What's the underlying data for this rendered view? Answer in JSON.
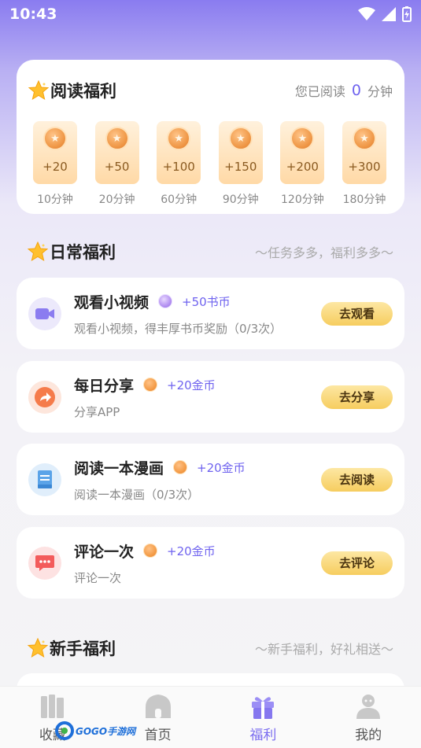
{
  "status_bar": {
    "time": "10:43"
  },
  "reading_welfare": {
    "title": "阅读福利",
    "read_prefix": "您已阅读",
    "read_minutes": "0",
    "read_suffix": "分钟",
    "rewards": [
      {
        "amount": "+20",
        "time": "10分钟"
      },
      {
        "amount": "+50",
        "time": "20分钟"
      },
      {
        "amount": "+100",
        "time": "60分钟"
      },
      {
        "amount": "+150",
        "time": "90分钟"
      },
      {
        "amount": "+200",
        "time": "120分钟"
      },
      {
        "amount": "+300",
        "time": "180分钟"
      }
    ]
  },
  "daily_welfare": {
    "title": "日常福利",
    "subtitle": "～任务多多，福利多多～",
    "tasks": [
      {
        "name": "观看小视频",
        "reward": "+50书币",
        "desc": "观看小视频，得丰厚书币奖励（0/3次）",
        "button": "去观看",
        "coin": "purple-coin-icon"
      },
      {
        "name": "每日分享",
        "reward": "+20金币",
        "desc": "分享APP",
        "button": "去分享",
        "coin": "gold-coin-icon"
      },
      {
        "name": "阅读一本漫画",
        "reward": "+20金币",
        "desc": "阅读一本漫画（0/3次）",
        "button": "去阅读",
        "coin": "gold-coin-icon"
      },
      {
        "name": "评论一次",
        "reward": "+20金币",
        "desc": "评论一次",
        "button": "去评论",
        "coin": "gold-coin-icon"
      }
    ]
  },
  "newbie_welfare": {
    "title": "新手福利",
    "subtitle": "～新手福利，好礼相送～"
  },
  "bottom_nav": [
    {
      "label": "收藏",
      "icon": "bookshelf-icon"
    },
    {
      "label": "首页",
      "icon": "home-icon"
    },
    {
      "label": "福利",
      "icon": "gift-icon",
      "active": true
    },
    {
      "label": "我的",
      "icon": "user-icon"
    }
  ],
  "watermark": {
    "text": "GOGO手游网"
  },
  "colors": {
    "accent": "#7a6cf0",
    "button": "#f6cd5f",
    "reward_text": "#6f63ef"
  }
}
